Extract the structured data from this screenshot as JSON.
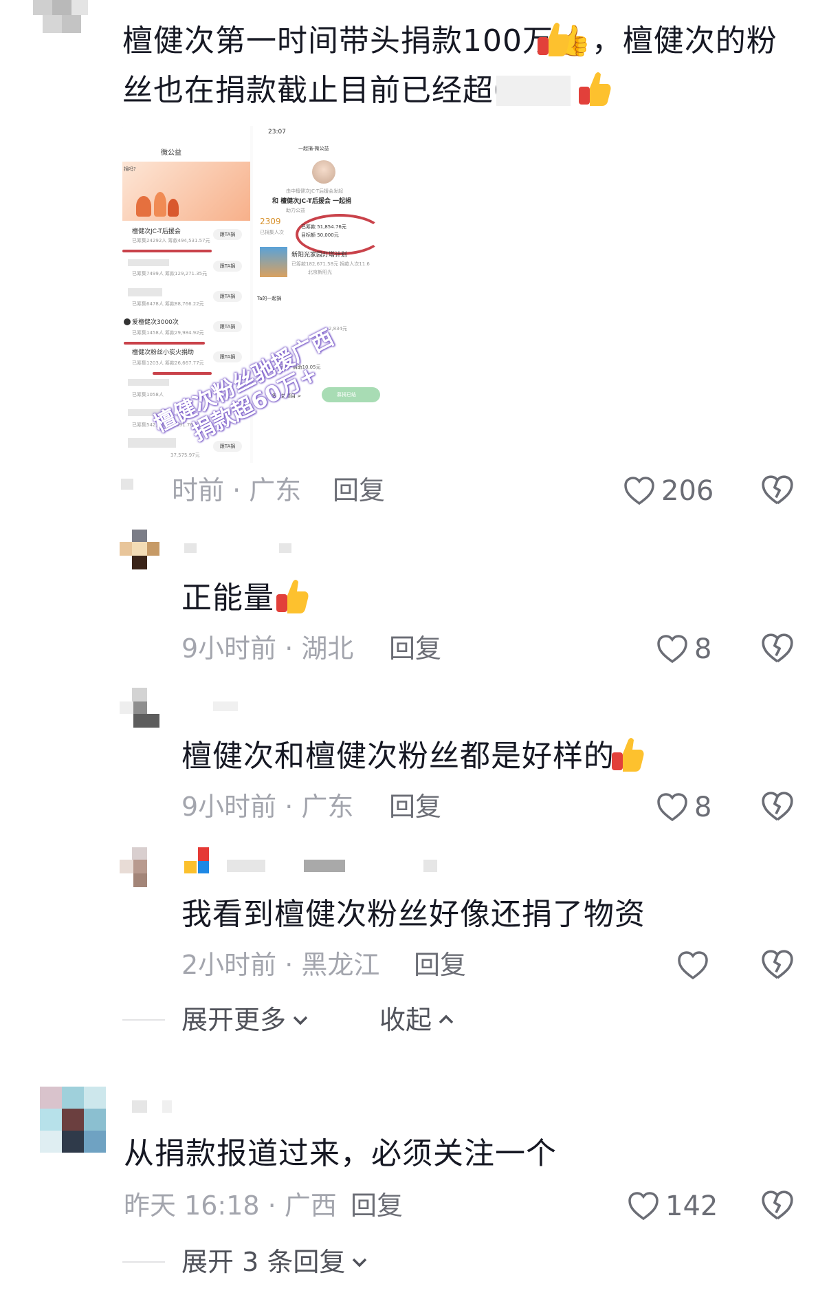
{
  "comments": [
    {
      "text": "檀健次第一时间带头捐款100万👍，檀健次的粉丝也在捐款截止目前已经超60",
      "time_region": "时前 · 广东",
      "reply_label": "回复",
      "likes": "206"
    },
    {
      "text": "正能量",
      "time_region": "9小时前 · 湖北",
      "reply_label": "回复",
      "likes": "8"
    },
    {
      "text": "檀健次和檀健次粉丝都是好样的",
      "time_region": "9小时前 · 广东",
      "reply_label": "回复",
      "likes": "8"
    },
    {
      "text": "我看到檀健次粉丝好像还捐了物资",
      "time_region": "2小时前 · 黑龙江",
      "reply_label": "回复",
      "likes": ""
    },
    {
      "text": "从捐款报道过来，必须关注一个",
      "time_region": "昨天 16:18 · 广西",
      "reply_label": "回复",
      "likes": "142"
    }
  ],
  "thread_controls": {
    "expand_more": "展开更多",
    "collapse": "收起",
    "expand_replies": "展开 3 条回复"
  },
  "screenshot": {
    "left_title": "微公益",
    "left_question": "捐吗?",
    "rows": [
      {
        "name": "檀健次JC-T后援会",
        "sub": "已筹集24292人 筹款494,531.57元",
        "btn": "跟TA捐"
      },
      {
        "name": "",
        "sub": "已筹集7499人 筹款129,271.35元",
        "btn": "跟TA捐"
      },
      {
        "name": "",
        "sub": "已筹集6478人 筹款88,766.22元",
        "btn": "跟TA捐"
      },
      {
        "name": "爱檀健次3000次",
        "sub": "已筹集1458人 筹款29,984.92元",
        "btn": "跟TA捐"
      },
      {
        "name": "檀健次粉丝小炭火捐助",
        "sub": "已筹集1203人 筹款26,667.77元",
        "btn": "跟TA捐"
      },
      {
        "name": "",
        "sub": "已筹集1058人",
        "btn": ""
      },
      {
        "name": "",
        "sub": "已筹集542人 筹款9,991.76元",
        "btn": ""
      },
      {
        "name": "",
        "sub": "37,575.97元",
        "btn": "跟TA捐"
      }
    ],
    "right_time": "23:07",
    "right_title": "一起捐-微公益",
    "right_host": "由中檀健次JC-T后援会发起",
    "right_heading": "和 檀健次JC-T后援会 一起捐",
    "right_help": "助力公益",
    "right_count": "2309",
    "right_count_label": "已捐集人次",
    "right_raised": "已筹款 51,854.76元",
    "right_target": "目标额 50,000元",
    "right_project": "新阳光家园灯塔计划",
    "right_project_sub": "已筹款182,671.58元 捐款人次11.6",
    "right_project_org": "北京新阳光",
    "right_section": "Ta的一起捐",
    "right_amount": "2,834元",
    "right_donor": "武***捐助10.05元",
    "right_more": "更多公益项目 >",
    "right_done": "募捐已结",
    "overlay_line1": "檀健次粉丝驰援广西",
    "overlay_line2": "捐款超60万+"
  },
  "colors": {
    "text": "#161823",
    "meta": "#a3a5ad",
    "accent_red": "#c9424a",
    "overlay_purple": "#7b5cc9"
  },
  "icons": [
    "thumbs-up-emoji",
    "heart-outline-icon",
    "broken-heart-icon",
    "chevron-down-icon",
    "chevron-up-icon"
  ]
}
